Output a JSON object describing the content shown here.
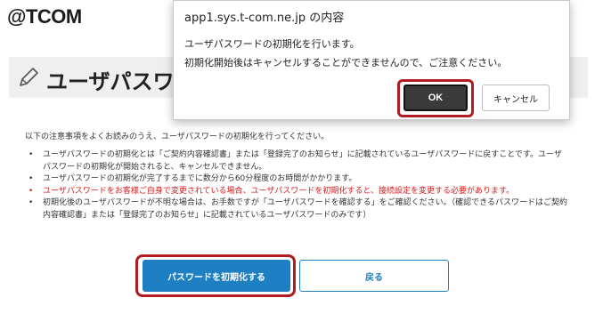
{
  "logo": {
    "text": "@TCOM"
  },
  "page": {
    "title": "ユーザパスワー",
    "intro": "以下の注意事項をよくお読みのうえ、ユーザパスワードの初期化を行ってください。",
    "notes": [
      {
        "text": "ユーザパスワードの初期化とは「ご契約内容確認書」または「登録完了のお知らせ」に記載されているユーザパスワードに戻すことです。ユーザパスワードの初期化が開始されると、キャンセルできません。",
        "warn": false
      },
      {
        "text": "ユーザパスワードの初期化が完了するまでに数分から60分程度のお時間がかかります。",
        "warn": false
      },
      {
        "text": "ユーザパスワードをお客様ご自身で変更されている場合、ユーザパスワードを初期化すると、接続設定を変更する必要があります。",
        "warn": true
      },
      {
        "text": "初期化後のユーザパスワードが不明な場合は、お手数ですが「ユーザパスワードを確認する」をご確認ください。（確認できるパスワードはご契約内容確認書」または「登録完了のお知らせ」に記載されているユーザパスワードのみです）",
        "warn": false
      }
    ],
    "init_button": "パスワードを初期化する",
    "back_button": "戻る"
  },
  "dialog": {
    "title": "app1.sys.t-com.ne.jp の内容",
    "message_line1": "ユーザパスワードの初期化を行います。",
    "message_line2": "初期化開始後はキャンセルすることができませんので、ご注意ください。",
    "ok_label": "OK",
    "cancel_label": "キャンセル"
  },
  "colors": {
    "accent_blue": "#1e7fc3",
    "highlight_red": "#b01c22",
    "warning_text": "#d81b1b",
    "ok_button_bg": "#3a3a3a"
  },
  "icons": {
    "title_icon": "pencil-icon"
  }
}
